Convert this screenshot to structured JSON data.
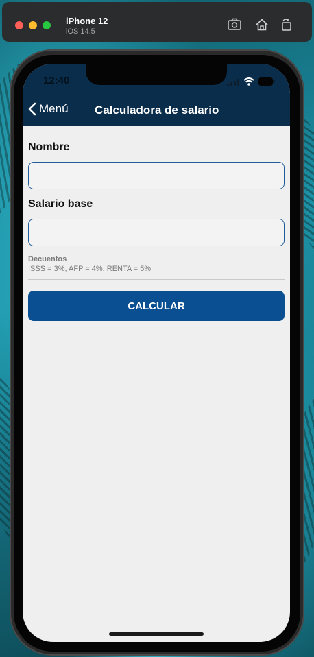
{
  "simulator": {
    "device_name": "iPhone 12",
    "os_version": "iOS 14.5",
    "tools": [
      "screenshot-icon",
      "home-icon",
      "rotate-icon"
    ]
  },
  "status_bar": {
    "time": "12:40"
  },
  "nav": {
    "back_label": "Menú",
    "title": "Calculadora de salario"
  },
  "form": {
    "name_label": "Nombre",
    "name_value": "",
    "salary_label": "Salario base",
    "salary_value": "",
    "hint_title": "Decuentos",
    "hint_text": "ISSS = 3%, AFP = 4%, RENTA = 5%",
    "button_label": "CALCULAR"
  },
  "colors": {
    "nav_background": "#0a2d4b",
    "button_background": "#0a4f91",
    "input_border": "#1f5c9a",
    "screen_background": "#efefef"
  }
}
